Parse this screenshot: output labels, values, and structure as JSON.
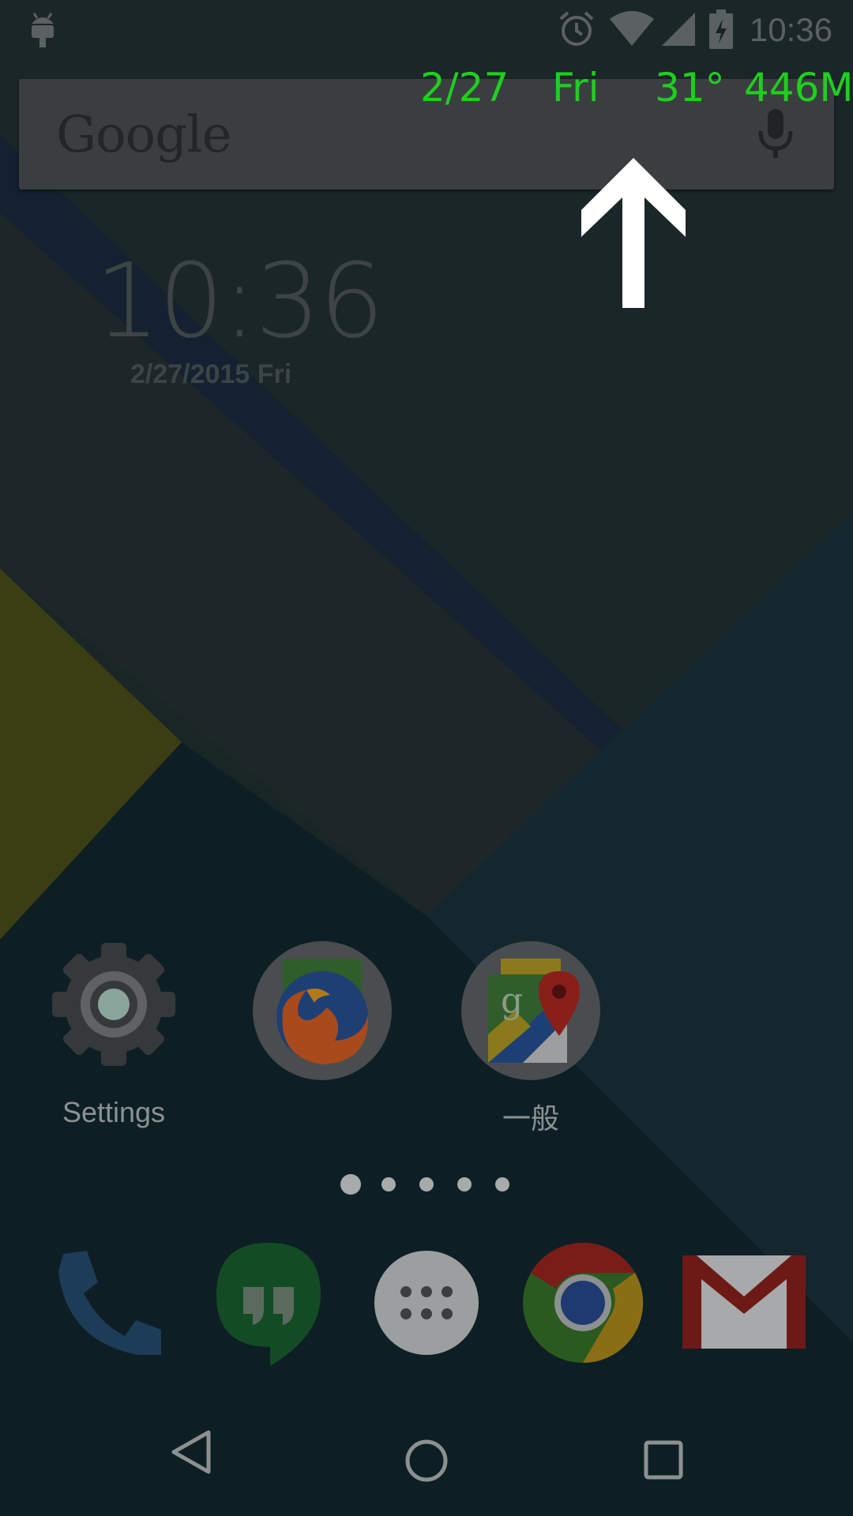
{
  "status_bar": {
    "time": "10:36",
    "icons": [
      "android-icon",
      "alarm-icon",
      "wifi-icon",
      "signal-icon",
      "battery-charging-icon"
    ]
  },
  "overlay": {
    "date": "2/27",
    "day": "Fri",
    "temperature": "31°",
    "memory": "446M",
    "color": "#1fcf1f"
  },
  "search": {
    "logo": "Google",
    "mic_icon": "mic-icon"
  },
  "clock_widget": {
    "time": "10:36",
    "date": "2/27/2015 Fri"
  },
  "apps": [
    {
      "label": "Settings",
      "icon": "settings-icon"
    },
    {
      "label": "",
      "icon": "firefox-icon"
    },
    {
      "label": "一般",
      "icon": "maps-folder-icon"
    }
  ],
  "page_indicator": {
    "pages": 5,
    "current": 1
  },
  "dock": [
    "phone-icon",
    "hangouts-icon",
    "app-drawer-icon",
    "chrome-icon",
    "gmail-icon"
  ],
  "navigation": [
    "back-icon",
    "home-icon",
    "recents-icon"
  ],
  "annotation": {
    "icon": "arrow-up-icon",
    "color": "#ffffff"
  }
}
